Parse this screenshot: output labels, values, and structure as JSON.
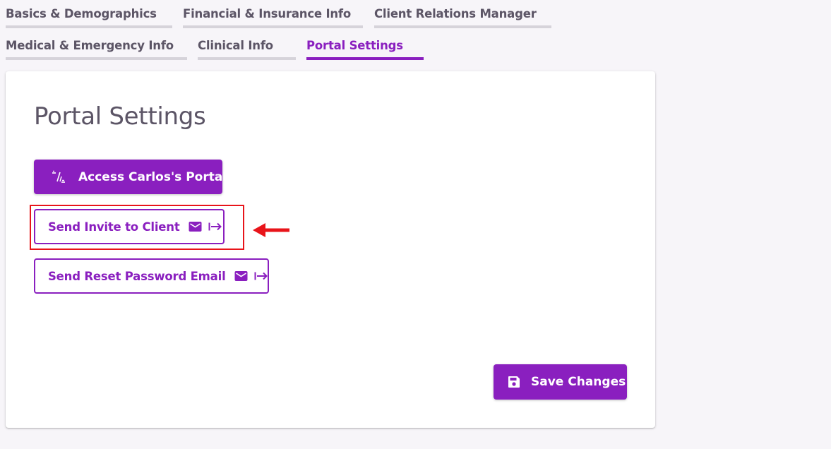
{
  "tabs": {
    "row1": [
      {
        "label": "Basics & Demographics"
      },
      {
        "label": "Financial & Insurance Info"
      },
      {
        "label": "Client Relations Manager"
      }
    ],
    "row2": [
      {
        "label": "Medical & Emergency Info"
      },
      {
        "label": "Clinical Info"
      },
      {
        "label": "Portal Settings",
        "active": true
      }
    ]
  },
  "card": {
    "title": "Portal Settings",
    "access_button": {
      "label": "Access Carlos's Portal",
      "icon": "portal-access-icon"
    },
    "invite_button": {
      "label": "Send Invite to Client",
      "icons": [
        "mail-icon",
        "send-arrow-icon"
      ]
    },
    "reset_button": {
      "label": "Send Reset Password Email",
      "icons": [
        "mail-icon",
        "send-arrow-icon"
      ]
    },
    "save_button": {
      "label": "Save Changes",
      "icon": "save-icon"
    }
  },
  "annotation": {
    "highlight_color": "#e8141a",
    "target": "invite_button"
  },
  "colors": {
    "accent": "#8a1fbf",
    "tab_text": "#5c5566",
    "tab_underline": "#d6d3da",
    "background": "#f7f5f9"
  }
}
